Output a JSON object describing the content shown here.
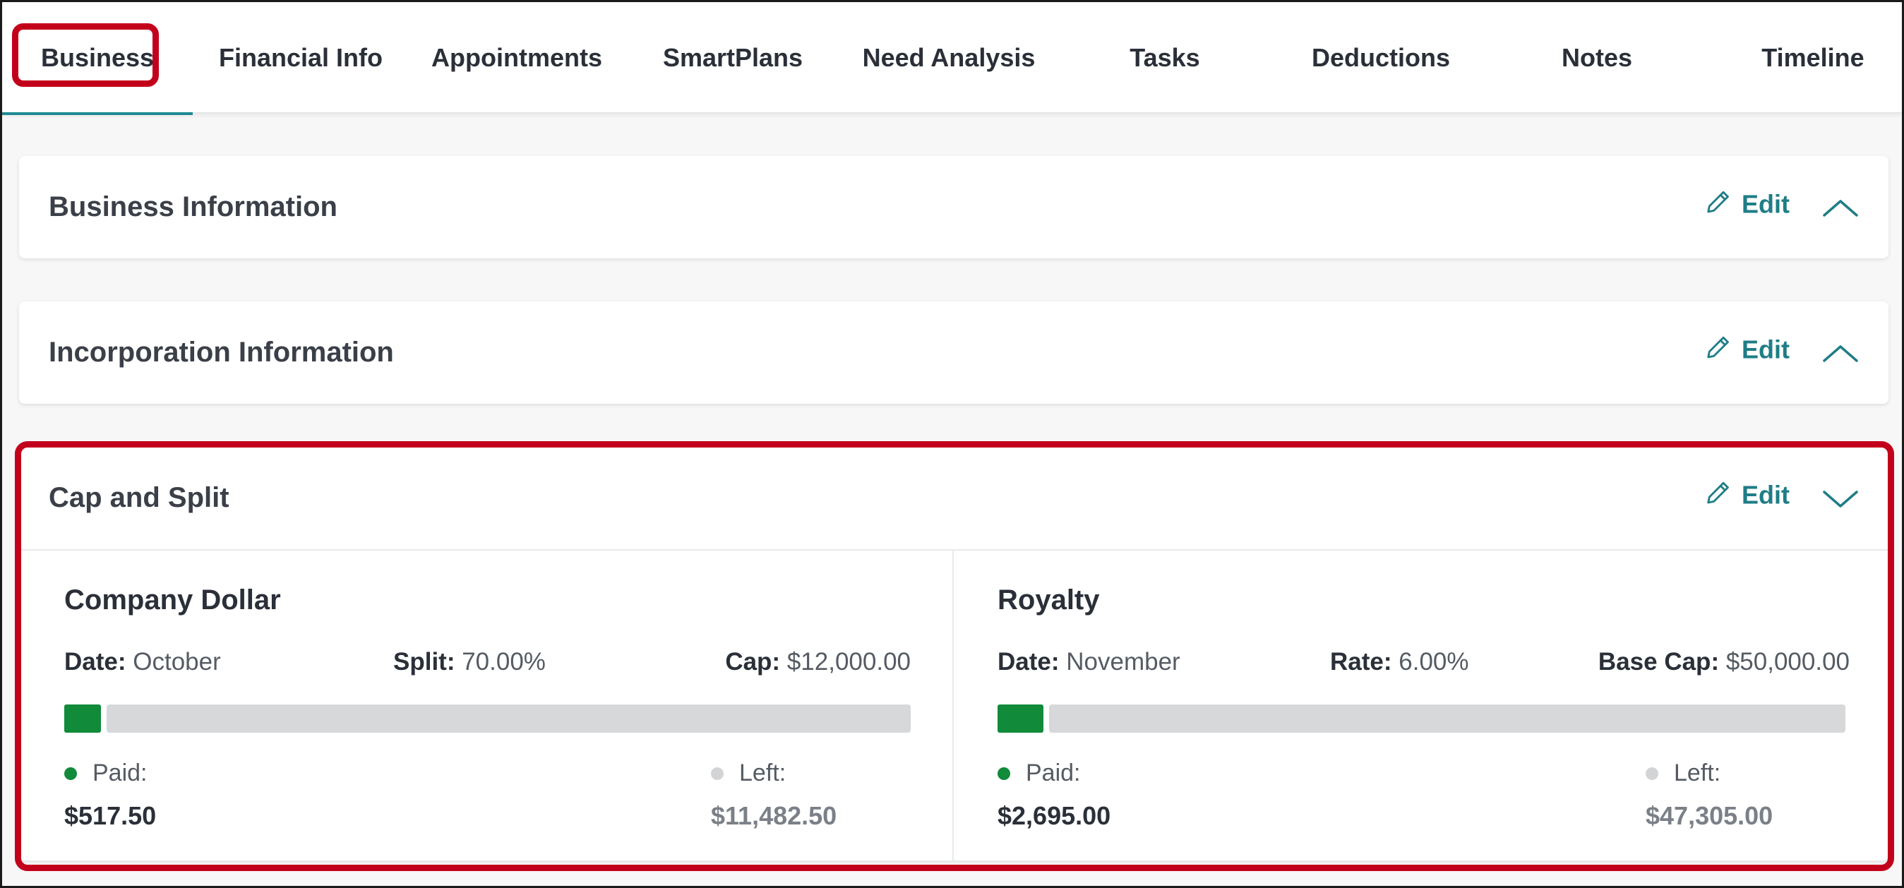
{
  "tabs": [
    {
      "label": "Business",
      "active": true
    },
    {
      "label": "Financial Info"
    },
    {
      "label": "Appointments"
    },
    {
      "label": "SmartPlans"
    },
    {
      "label": "Need Analysis"
    },
    {
      "label": "Tasks"
    },
    {
      "label": "Deductions"
    },
    {
      "label": "Notes"
    },
    {
      "label": "Timeline"
    }
  ],
  "sections": {
    "business_info": {
      "title": "Business Information",
      "edit_label": "Edit",
      "expanded": false
    },
    "incorporation_info": {
      "title": "Incorporation Information",
      "edit_label": "Edit",
      "expanded": false
    },
    "cap_and_split": {
      "title": "Cap and Split",
      "edit_label": "Edit",
      "expanded": true,
      "company_dollar": {
        "title": "Company Dollar",
        "date_label": "Date:",
        "date_value": "October",
        "split_label": "Split:",
        "split_value": "70.00%",
        "cap_label": "Cap:",
        "cap_value": "$12,000.00",
        "paid_label": "Paid:",
        "paid_value": "$517.50",
        "left_label": "Left:",
        "left_value": "$11,482.50",
        "progress_fraction": 0.0431
      },
      "royalty": {
        "title": "Royalty",
        "date_label": "Date:",
        "date_value": "November",
        "rate_label": "Rate:",
        "rate_value": "6.00%",
        "base_cap_label": "Base Cap:",
        "base_cap_value": "$50,000.00",
        "paid_label": "Paid:",
        "paid_value": "$2,695.00",
        "left_label": "Left:",
        "left_value": "$47,305.00",
        "progress_fraction": 0.0539
      }
    }
  },
  "colors": {
    "accent": "#1f8a92",
    "edit": "#1f7d86",
    "paid": "#118a3a",
    "left": "#d3d4d6",
    "highlight": "#c3001b"
  },
  "icons": {
    "edit": "pencil-icon",
    "collapse": "chevron-up-icon",
    "expand": "chevron-down-icon"
  }
}
